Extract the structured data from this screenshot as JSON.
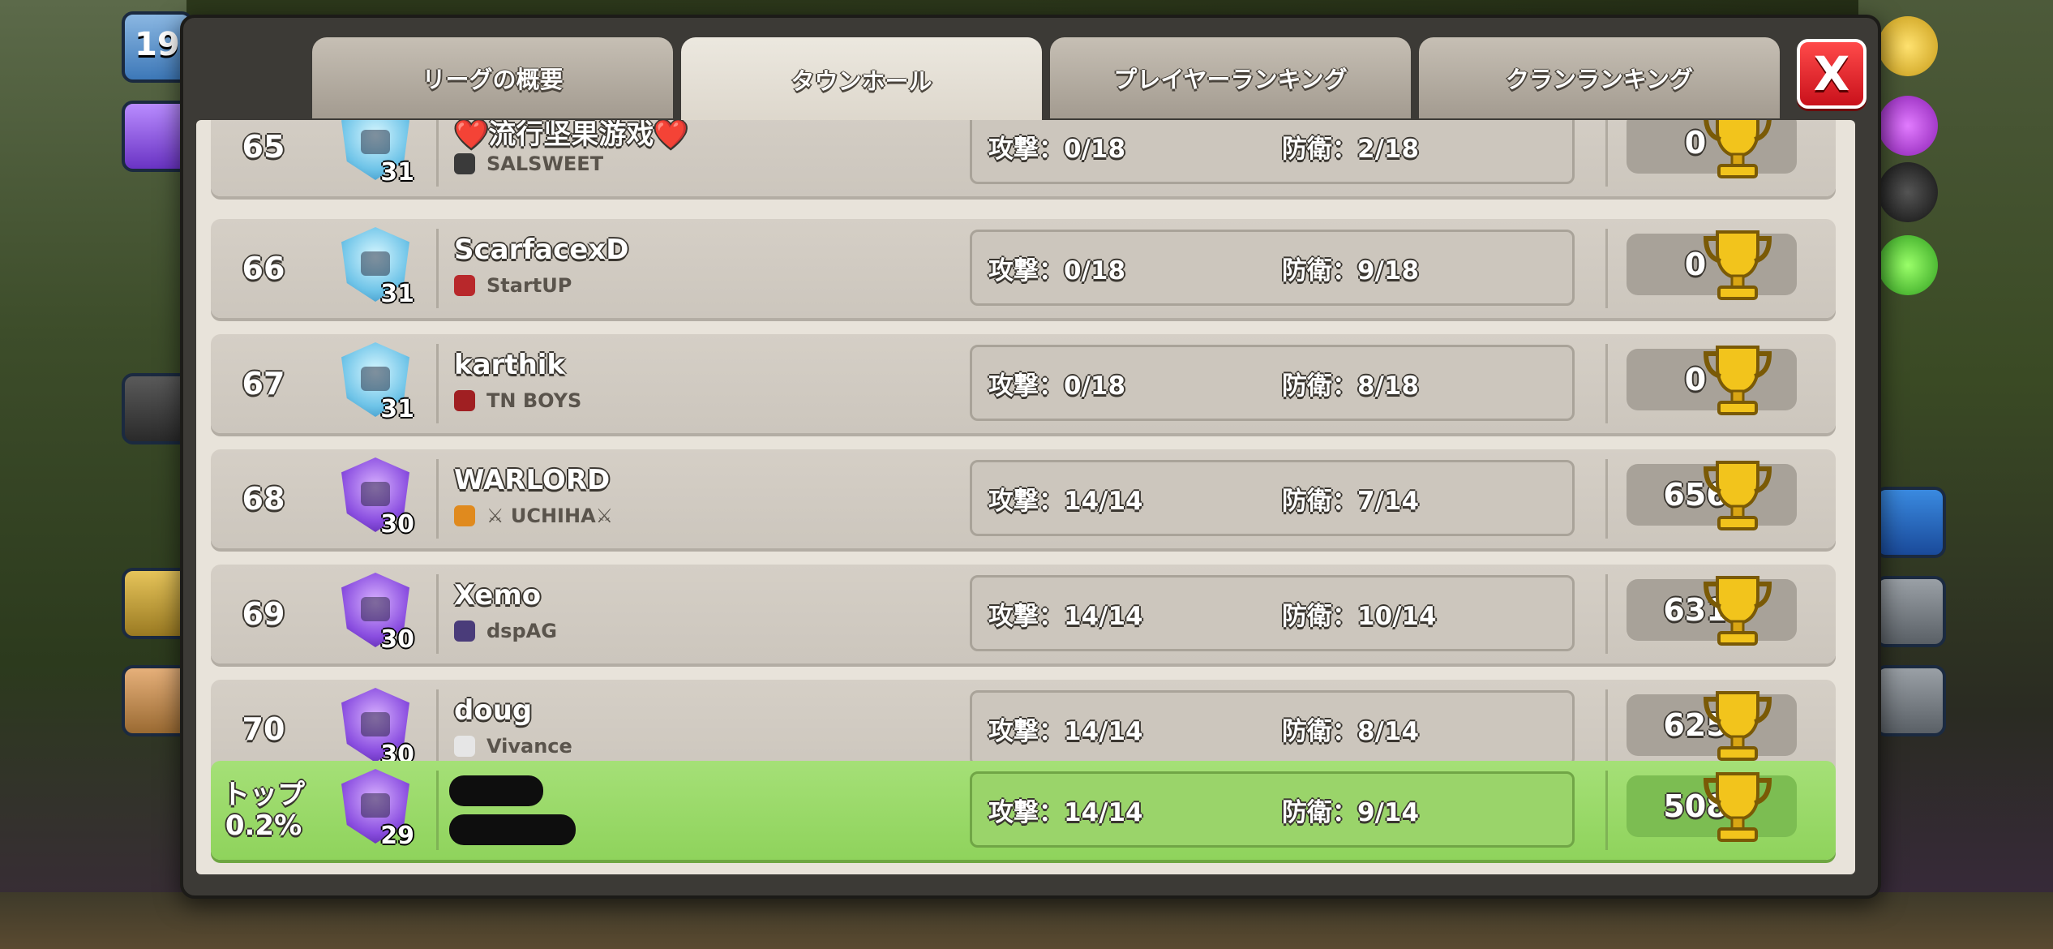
{
  "tabs": [
    {
      "label": "リーグの概要",
      "active": false
    },
    {
      "label": "タウンホール",
      "active": true
    },
    {
      "label": "プレイヤーランキング",
      "active": false
    },
    {
      "label": "クランランキング",
      "active": false
    }
  ],
  "close_label": "X",
  "side": {
    "top_badge": "19"
  },
  "rows": [
    {
      "rank": "65",
      "th_level": "31",
      "th_style": "ice",
      "name": "❤️流行坚果游戏❤️",
      "clan": "SALSWEET",
      "clan_color": "#3a3a3a",
      "attack": "攻撃：0/18",
      "defense": "防衛：2/18",
      "trophies": "0"
    },
    {
      "rank": "66",
      "th_level": "31",
      "th_style": "ice",
      "name": "ScarfacexD",
      "clan": "StartUP",
      "clan_color": "#b8282b",
      "attack": "攻撃：0/18",
      "defense": "防衛：9/18",
      "trophies": "0"
    },
    {
      "rank": "67",
      "th_level": "31",
      "th_style": "ice",
      "name": "karthik",
      "clan": "TN BOYS",
      "clan_color": "#a01f22",
      "attack": "攻撃：0/18",
      "defense": "防衛：8/18",
      "trophies": "0"
    },
    {
      "rank": "68",
      "th_level": "30",
      "th_style": "purple",
      "name": "WARLORD",
      "clan": "⚔ UCHIHA⚔",
      "clan_color": "#e08a1e",
      "attack": "攻撃：14/14",
      "defense": "防衛：7/14",
      "trophies": "656"
    },
    {
      "rank": "69",
      "th_level": "30",
      "th_style": "purple",
      "name": "Xemo",
      "clan": "dspAG",
      "clan_color": "#4a3c7a",
      "attack": "攻撃：14/14",
      "defense": "防衛：10/14",
      "trophies": "631"
    },
    {
      "rank": "70",
      "th_level": "30",
      "th_style": "purple",
      "name": "doug",
      "clan": "Vivance",
      "clan_color": "#e6e6e6",
      "attack": "攻撃：14/14",
      "defense": "防衛：8/14",
      "trophies": "625"
    }
  ],
  "my_row": {
    "rank_line1": "トップ",
    "rank_line2": "0.2%",
    "th_level": "29",
    "attack": "攻撃：14/14",
    "defense": "防衛：9/14",
    "trophies": "508"
  }
}
